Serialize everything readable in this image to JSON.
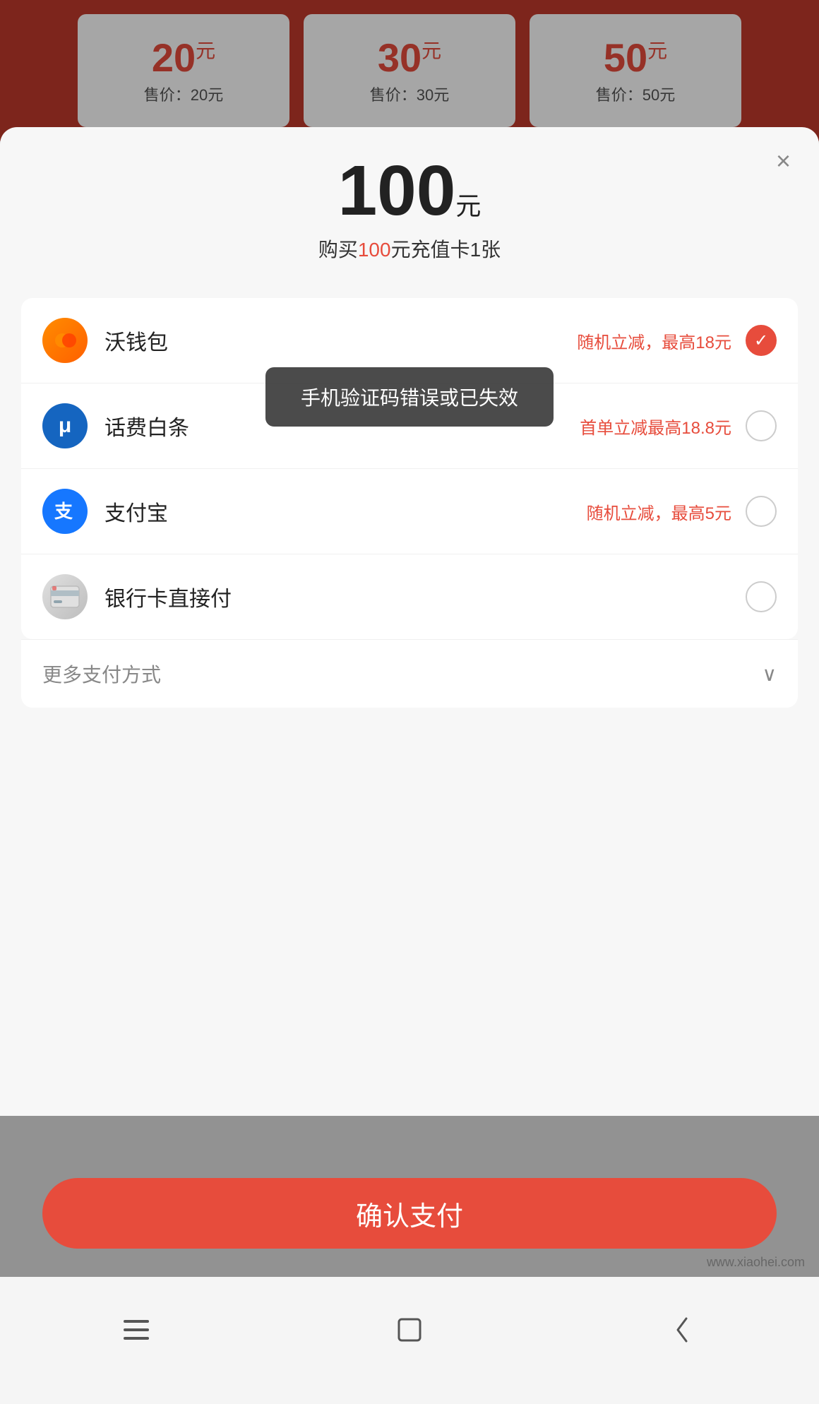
{
  "top": {
    "cards": [
      {
        "amount": "20",
        "unit": "元",
        "price_label": "售价：20元"
      },
      {
        "amount": "30",
        "unit": "元",
        "price_label": "售价：30元"
      },
      {
        "amount": "50",
        "unit": "元",
        "price_label": "售价：50元"
      }
    ]
  },
  "modal": {
    "close_label": "×",
    "amount": "100",
    "amount_unit": "元",
    "description_prefix": "购买",
    "description_amount": "100",
    "description_suffix": "元充值卡1张",
    "payment_methods": [
      {
        "id": "wo",
        "name": "沃钱包",
        "discount": "随机立减，最高18元",
        "selected": true,
        "icon_text": "🔴"
      },
      {
        "id": "ubill",
        "name": "话费白条",
        "discount": "首单立减最高18.8元",
        "selected": false,
        "icon_text": "μ"
      },
      {
        "id": "alipay",
        "name": "支付宝",
        "discount": "随机立减，最高5元",
        "selected": false,
        "icon_text": "支"
      },
      {
        "id": "bank",
        "name": "银行卡直接付",
        "discount": "",
        "selected": false,
        "icon_text": "🏦"
      }
    ],
    "more_payment_label": "更多支付方式"
  },
  "toast": {
    "message": "手机验证码错误或已失效"
  },
  "confirm_button": {
    "label": "确认支付"
  },
  "nav_bar": {
    "menu_icon": "≡",
    "home_icon": "□",
    "back_icon": "‹"
  },
  "watermark": "www.xiaohei.com"
}
